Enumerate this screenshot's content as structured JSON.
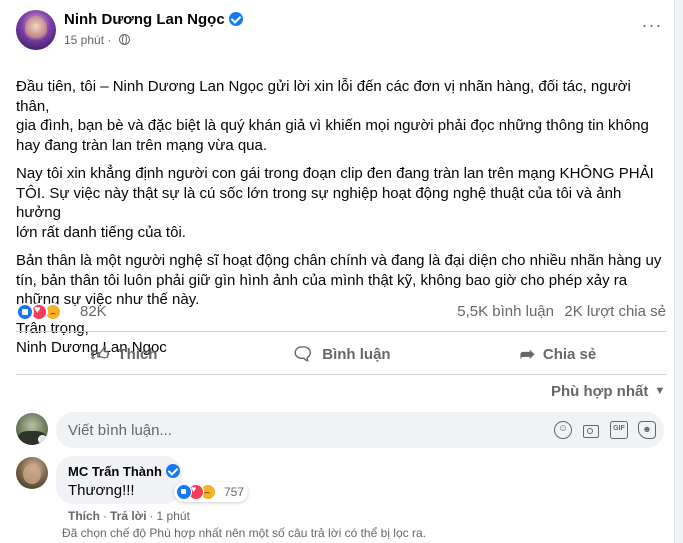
{
  "post": {
    "author": "Ninh Dương Lan Ngọc",
    "time": "15 phút",
    "separator": "·",
    "more_label": "···",
    "paragraphs": [
      "Đầu tiên, tôi – Ninh Dương Lan Ngọc gửi lời xin lỗi đến các đơn vị nhãn hàng, đối tác, người thân,\ngia đình, bạn bè và đặc biệt là quý khán giả vì khiến mọi người phải đọc những thông tin không\nhay đang tràn lan trên mạng vừa qua.",
      "Nay tôi xin khẳng định người con gái trong đoạn clip đen đang tràn lan trên mạng KHÔNG PHẢI\nTÔI. Sự việc này thật sự là cú sốc lớn trong sự nghiệp hoạt động nghệ thuật của tôi và ảnh hưởng\nlớn rất danh tiếng của tôi.",
      "Bản thân là một người nghệ sĩ hoạt động chân chính và đang là đại diện cho nhiều nhãn hàng uy\ntín, bản thân tôi luôn phải giữ gìn hình ảnh của mình thật kỹ, không bao giờ cho phép xảy ra\nnhững sự việc như thế này."
    ],
    "closing": "Trân trọng,\nNinh Dương Lan Ngọc"
  },
  "stats": {
    "reactions": "82K",
    "comments": "5,5K bình luận",
    "shares": "2K lượt chia sẻ"
  },
  "actions": {
    "like": "Thích",
    "comment": "Bình luận",
    "share": "Chia sẻ"
  },
  "sort": {
    "label": "Phù hợp nhất",
    "icon": "caret-down-icon"
  },
  "composer": {
    "placeholder": "Viết bình luận...",
    "emoji_glyph": "☺",
    "gif_label": "GIF",
    "sticker_glyph": "☻"
  },
  "comment": {
    "author": "MC Trấn Thành",
    "text": "Thương!!!",
    "reaction_count": "757",
    "like_label": "Thích",
    "reply_label": "Trả lời",
    "separator": "·",
    "time": "1 phút"
  },
  "notice": "Đã chọn chế độ Phù hợp nhất nên một số câu trả lời có thể bị lọc ra.",
  "colors": {
    "accent": "#1877f2",
    "love": "#f33e58",
    "sad": "#f7b125",
    "secondary_text": "#65676b"
  }
}
